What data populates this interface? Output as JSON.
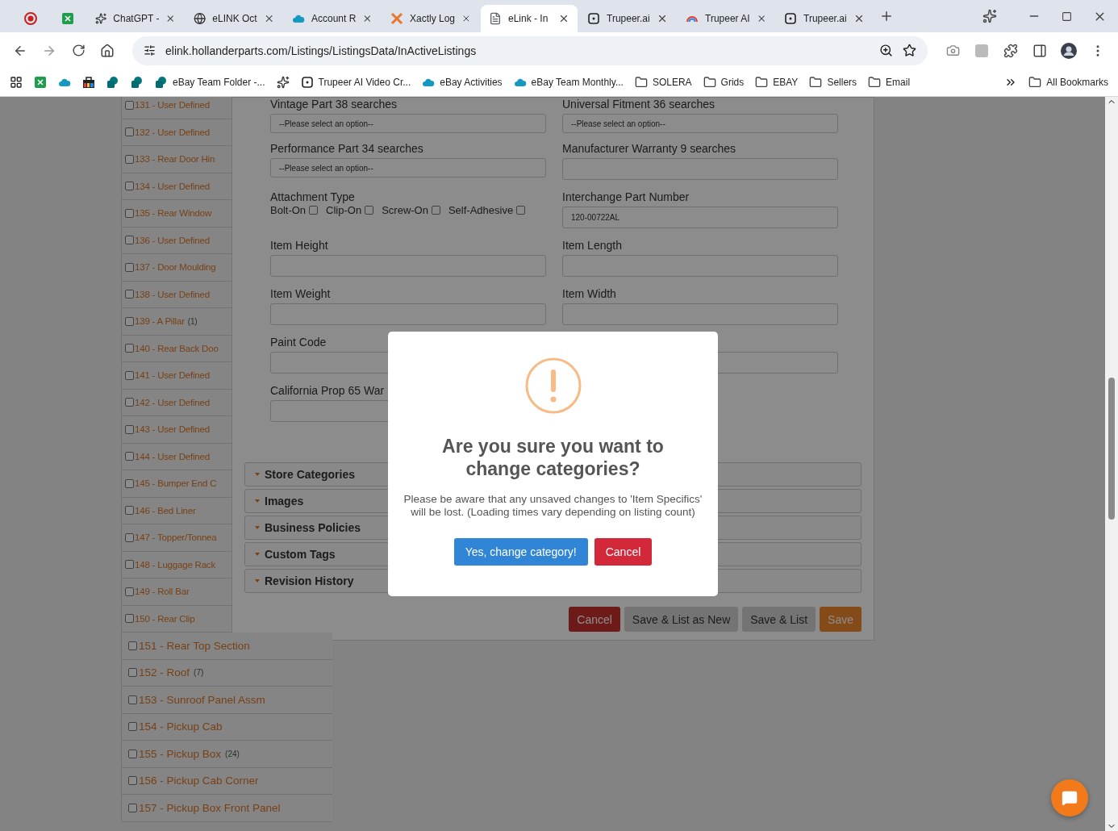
{
  "browser": {
    "tabs": [
      {
        "kind": "record",
        "selected": false
      },
      {
        "kind": "sheet",
        "selected": false
      },
      {
        "kind": "openai",
        "title": "ChatGPT -",
        "selected": false
      },
      {
        "kind": "globe",
        "title": "eLINK Oct",
        "selected": false
      },
      {
        "kind": "cloud",
        "title": "Account R",
        "selected": false
      },
      {
        "kind": "xmark",
        "title": "Xactly Log",
        "selected": false
      },
      {
        "kind": "doc",
        "title": "eLink - In",
        "selected": true
      },
      {
        "kind": "square",
        "title": "Trupeer.ai",
        "selected": false
      },
      {
        "kind": "rainbow",
        "title": "Trupeer AI",
        "selected": false
      },
      {
        "kind": "square",
        "title": "Trupeer.ai",
        "selected": false
      }
    ],
    "url": "elink.hollanderparts.com/Listings/ListingsData/InActiveListings",
    "bookmarks": [
      {
        "kind": "sheet"
      },
      {
        "kind": "cloud"
      },
      {
        "kind": "bag"
      },
      {
        "kind": "sharepoint"
      },
      {
        "kind": "sharepoint"
      },
      {
        "kind": "sharepoint",
        "label": "eBay Team Folder -..."
      },
      {
        "kind": "openai"
      },
      {
        "kind": "square",
        "label": "Trupeer AI Video Cr..."
      },
      {
        "kind": "cloud",
        "label": "eBay Activities"
      },
      {
        "kind": "cloud",
        "label": "eBay Team Monthly..."
      },
      {
        "kind": "folder",
        "label": "SOLERA"
      },
      {
        "kind": "folder",
        "label": "Grids"
      },
      {
        "kind": "folder",
        "label": "EBAY"
      },
      {
        "kind": "folder",
        "label": "Sellers"
      },
      {
        "kind": "folder",
        "label": "Email"
      }
    ],
    "all_bookmarks": "All Bookmarks"
  },
  "categories": [
    {
      "label": "131 - User Defined",
      "checked": false
    },
    {
      "label": "132 - User Defined",
      "checked": false
    },
    {
      "label": "133 - Rear Door Hin",
      "checked": false
    },
    {
      "label": "134 - User Defined",
      "checked": false
    },
    {
      "label": "135 - Rear Window",
      "checked": false
    },
    {
      "label": "136 - User Defined",
      "checked": false
    },
    {
      "label": "137 - Door Moulding",
      "checked": false
    },
    {
      "label": "138 - User Defined",
      "checked": false
    },
    {
      "label": "139 - A Pillar",
      "count": "(1)",
      "checked": false
    },
    {
      "label": "140 - Rear Back Doo",
      "checked": false
    },
    {
      "label": "141 - User Defined",
      "checked": false
    },
    {
      "label": "142 - User Defined",
      "checked": false
    },
    {
      "label": "143 - User Defined",
      "checked": false
    },
    {
      "label": "144 - User Defined",
      "checked": false
    },
    {
      "label": "145 - Bumper End C",
      "checked": false
    },
    {
      "label": "146 - Bed Liner",
      "checked": false
    },
    {
      "label": "147 - Topper/Tonnea",
      "checked": false
    },
    {
      "label": "148 - Luggage Rack",
      "checked": false
    },
    {
      "label": "149 - Roll Bar",
      "checked": false
    },
    {
      "label": "150 - Rear Clip",
      "checked": false
    },
    {
      "label": "151 - Rear Top Section",
      "checked": false
    },
    {
      "label": "152 - Roof",
      "count": "(7)",
      "checked": false
    },
    {
      "label": "153 - Sunroof Panel Assm",
      "checked": false
    },
    {
      "label": "154 - Pickup Cab",
      "checked": false
    },
    {
      "label": "155 - Pickup Box",
      "count": "(24)",
      "checked": false
    },
    {
      "label": "156 - Pickup Cab Corner",
      "checked": false
    },
    {
      "label": "157 - Pickup Box Front Panel",
      "checked": false
    }
  ],
  "form": {
    "left": [
      {
        "kind": "select",
        "label": "Vintage Part 38 searches",
        "value": "--Please select an option--"
      },
      {
        "kind": "select",
        "label": "Performance Part 34 searches",
        "value": "--Please select an option--"
      },
      {
        "kind": "checkboxes",
        "label": "Attachment Type",
        "options": [
          {
            "label": "Bolt-On",
            "checked": false
          },
          {
            "label": "Clip-On",
            "checked": false
          },
          {
            "label": "Screw-On",
            "checked": false
          },
          {
            "label": "Self-Adhesive",
            "checked": false
          }
        ]
      },
      {
        "kind": "input",
        "label": "Item Height"
      },
      {
        "kind": "input",
        "label": "Item Weight"
      },
      {
        "kind": "input",
        "label": "Paint Code"
      },
      {
        "kind": "input",
        "label": "California Prop 65 War"
      }
    ],
    "right": [
      {
        "kind": "select",
        "label": "Universal Fitment 36 searches",
        "value": "--Please select an option--"
      },
      {
        "kind": "input",
        "label": "Manufacturer Warranty 9 searches"
      },
      {
        "kind": "input",
        "label": "Interchange Part Number",
        "value": "120-00722AL"
      },
      {
        "kind": "input",
        "label": "Item Length"
      },
      {
        "kind": "input",
        "label": "Item Width"
      },
      {
        "kind": "input"
      }
    ]
  },
  "sections": [
    {
      "label": "Store Categories"
    },
    {
      "label": "Images"
    },
    {
      "label": "Business Policies"
    },
    {
      "label": "Custom Tags"
    },
    {
      "label": "Revision History"
    }
  ],
  "actions": [
    {
      "label": "Cancel",
      "kind": "danger"
    },
    {
      "label": "Save & List as New",
      "kind": "secondary"
    },
    {
      "label": "Save & List",
      "kind": "secondary"
    },
    {
      "label": "Save",
      "kind": "warning"
    }
  ],
  "modal": {
    "title": "Are you sure you want to change categories?",
    "message": "Please be aware that any unsaved changes to 'Item Specifics' will be lost. (Loading times vary depending on listing count)",
    "confirm": "Yes, change category!",
    "cancel": "Cancel"
  }
}
